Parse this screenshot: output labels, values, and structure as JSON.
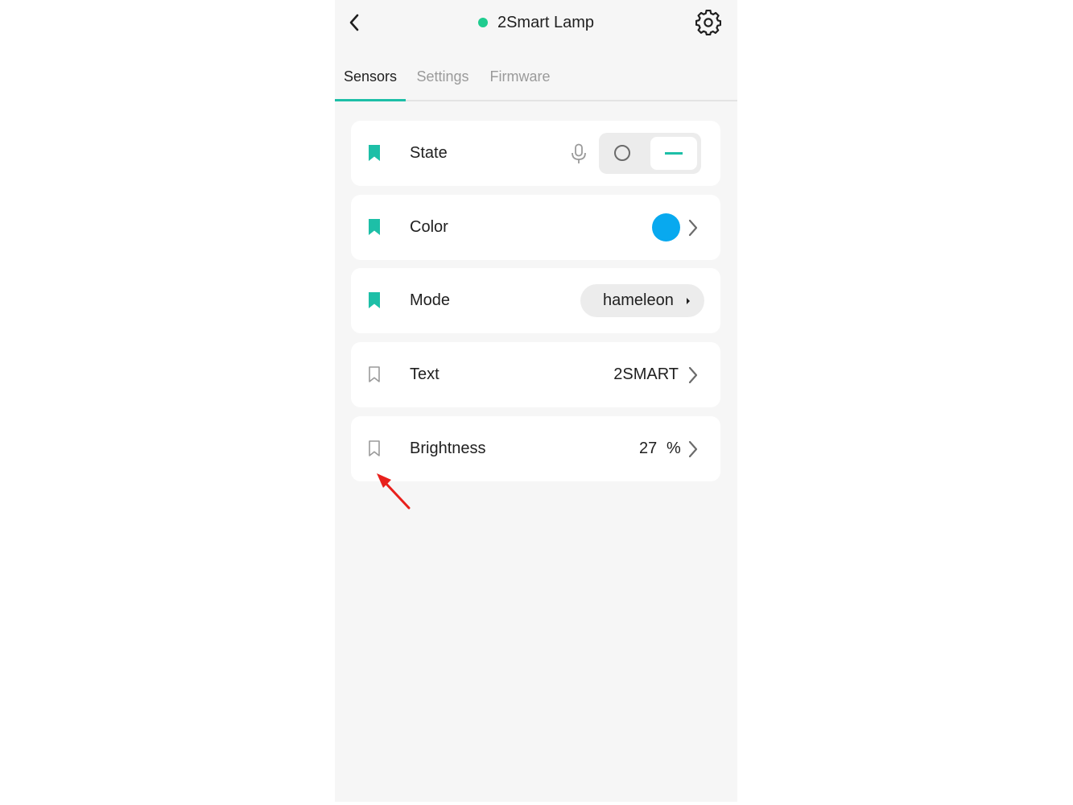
{
  "header": {
    "title": "2Smart Lamp",
    "status_color": "#1fcc8f"
  },
  "tabs": [
    {
      "label": "Sensors",
      "active": true
    },
    {
      "label": "Settings",
      "active": false
    },
    {
      "label": "Firmware",
      "active": false
    }
  ],
  "colors": {
    "accent": "#1dbfa7",
    "color_swatch": "#08a9ef",
    "annotation": "#e8201c"
  },
  "sensors": [
    {
      "label": "State",
      "bookmarked": true,
      "control": "toggle",
      "toggle_on": true
    },
    {
      "label": "Color",
      "bookmarked": true,
      "control": "color"
    },
    {
      "label": "Mode",
      "bookmarked": true,
      "control": "select",
      "value": "hameleon"
    },
    {
      "label": "Text",
      "bookmarked": false,
      "control": "text",
      "value": "2SMART"
    },
    {
      "label": "Brightness",
      "bookmarked": false,
      "control": "number",
      "value": "27",
      "unit": "%"
    }
  ]
}
